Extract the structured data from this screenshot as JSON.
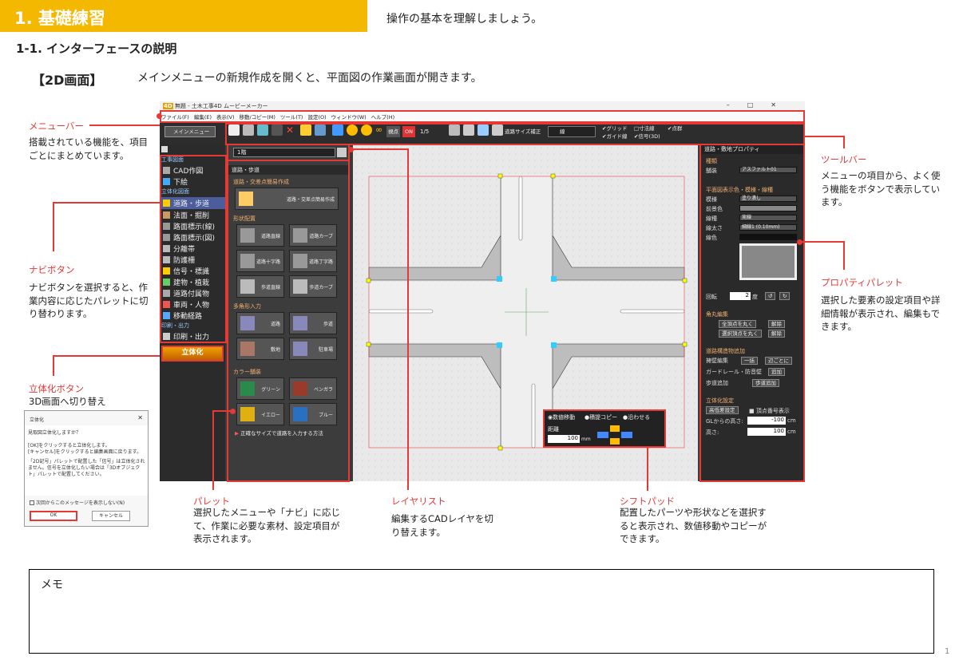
{
  "header": {
    "title": "1. 基礎練習",
    "subtitle": "操作の基本を理解しましょう。"
  },
  "section": {
    "title": "1-1. インターフェースの説明"
  },
  "mode": {
    "tag": "【2D画面】",
    "description": "メインメニューの新規作成を開くと、平面図の作業画面が開きます。"
  },
  "annotations": {
    "menubar": {
      "title": "メニューバー",
      "desc": "搭載されている機能を、項目ごとにまとめています。"
    },
    "navi": {
      "title": "ナビボタン",
      "desc": "ナビボタンを選択すると、作業内容に応じたパレットに切り替わります。"
    },
    "rittai": {
      "title": "立体化ボタン",
      "desc": "3D画面へ切り替え"
    },
    "palette": {
      "title": "パレット",
      "desc": "選択したメニューや「ナビ」に応じて、作業に必要な素材、設定項目が表示されます。"
    },
    "layer": {
      "title": "レイヤリスト",
      "desc": "編集するCADレイヤを切り替えます。"
    },
    "shift": {
      "title": "シフトパッド",
      "desc": "配置したパーツや形状などを選択すると表示され、数値移動やコピーができます。"
    },
    "toolbar": {
      "title": "ツールバー",
      "desc": "メニューの項目から、よく使う機能をボタンで表示しています。"
    },
    "property": {
      "title": "プロパティパレット",
      "desc": "選択した要素の設定項目や詳細情報が表示され、編集もできます。"
    }
  },
  "app": {
    "title": "無題 - 土木工事4D ムービーメーカー",
    "menu": [
      "ファイル(F)",
      "編集(E)",
      "表示(V)",
      "移動/コピー(M)",
      "ツール(T)",
      "設定(O)",
      "ウィンドウ(W)",
      "ヘルプ(H)"
    ],
    "toolbar": {
      "main_menu": "メインメニュー",
      "sokudo": "視点",
      "on": "ON",
      "scale": "1/5",
      "road_fix": "道路サイズ補正",
      "line": "線",
      "grid": "グリッド",
      "guide": "ガイド線",
      "dim": "寸法線",
      "signal": "信号(3D)",
      "point": "点群"
    },
    "nav": {
      "head1": "工事図面",
      "head2": "立体化図面",
      "head3": "印刷・出力",
      "items": [
        "CAD作図",
        "下絵",
        "道路・歩道",
        "法面・掘削",
        "路面標示(線)",
        "路面標示(図)",
        "分離帯",
        "防護柵",
        "信号・標識",
        "建物・植栽",
        "道路付属物",
        "車両・人物",
        "移動経路",
        "印刷・出力"
      ],
      "rittai": "立体化"
    },
    "palette": {
      "layer": "1階",
      "title": "道路・歩道",
      "sec1": "道路・交差点簡易作成",
      "btn_simple": "道路・交差点簡易作成",
      "sec2": "形状配置",
      "shapes": [
        "道路直線",
        "道路カーブ",
        "道路十字路",
        "道路丁字路",
        "歩道直線",
        "歩道カーブ"
      ],
      "sec3": "多角形入力",
      "poly": [
        "道路",
        "歩道",
        "敷地",
        "駐車場"
      ],
      "sec4": "カラー舗装",
      "colors": [
        "グリーン",
        "ベンガラ",
        "イエロー",
        "ブルー"
      ],
      "link": "正確なサイズで道路を入力する方法"
    },
    "property": {
      "title": "道路・敷地プロパティ",
      "kind": "種類",
      "pave_label": "舗装",
      "pave": "アスファルト01",
      "sec_display": "平面図表示色・模様・線種",
      "pattern_label": "模様",
      "pattern": "塗り潰し",
      "fg_label": "前景色",
      "ltype_label": "線種",
      "ltype": "実線",
      "lw_label": "線太さ",
      "lw": "細線1 (0.10mm)",
      "lcolor_label": "線色",
      "rot_label": "回転",
      "rot": "2",
      "deg": "度",
      "sec_corner": "角丸編集",
      "all_corner": "全頂点を丸く",
      "release": "解除",
      "sel_corner": "選択頂点を丸く",
      "sec_struct": "道路構造物追加",
      "wall": "擁壁編集",
      "batch": "一括",
      "each": "辺ごとに",
      "guard": "ガードレール・防音壁",
      "add": "追加",
      "side": "歩道追加",
      "side_btn": "歩道追加",
      "sec_3d": "立体化設定",
      "height_set": "高低差設定",
      "vertex": "頂点番号表示",
      "gl_label": "GLからの高さ:",
      "gl": "-100",
      "cm": "cm",
      "h_label": "高さ:",
      "h": "100"
    },
    "shift": {
      "opt1": "数値移動",
      "opt2": "積提コピー",
      "opt3": "沿わせる",
      "dist": "距離",
      "val": "100",
      "unit": "mm"
    }
  },
  "dialog": {
    "title": "立体化",
    "q": "見取図立体化しますか？",
    "l1": "[OK]をクリックすると立体化します。",
    "l2": "[キャンセル]をクリックすると編集画面に戻ります。",
    "l3": "「2D記号」パレットで配置した「信号」は立体化されません。信号を立体化したい場合は「3Dオブジェクト」パレットで配置してください。",
    "chk": "次回からこのメッセージを表示しない(N)",
    "ok": "OK",
    "cancel": "キャンセル"
  },
  "memo": {
    "label": "メモ"
  },
  "page": {
    "number": "1"
  }
}
